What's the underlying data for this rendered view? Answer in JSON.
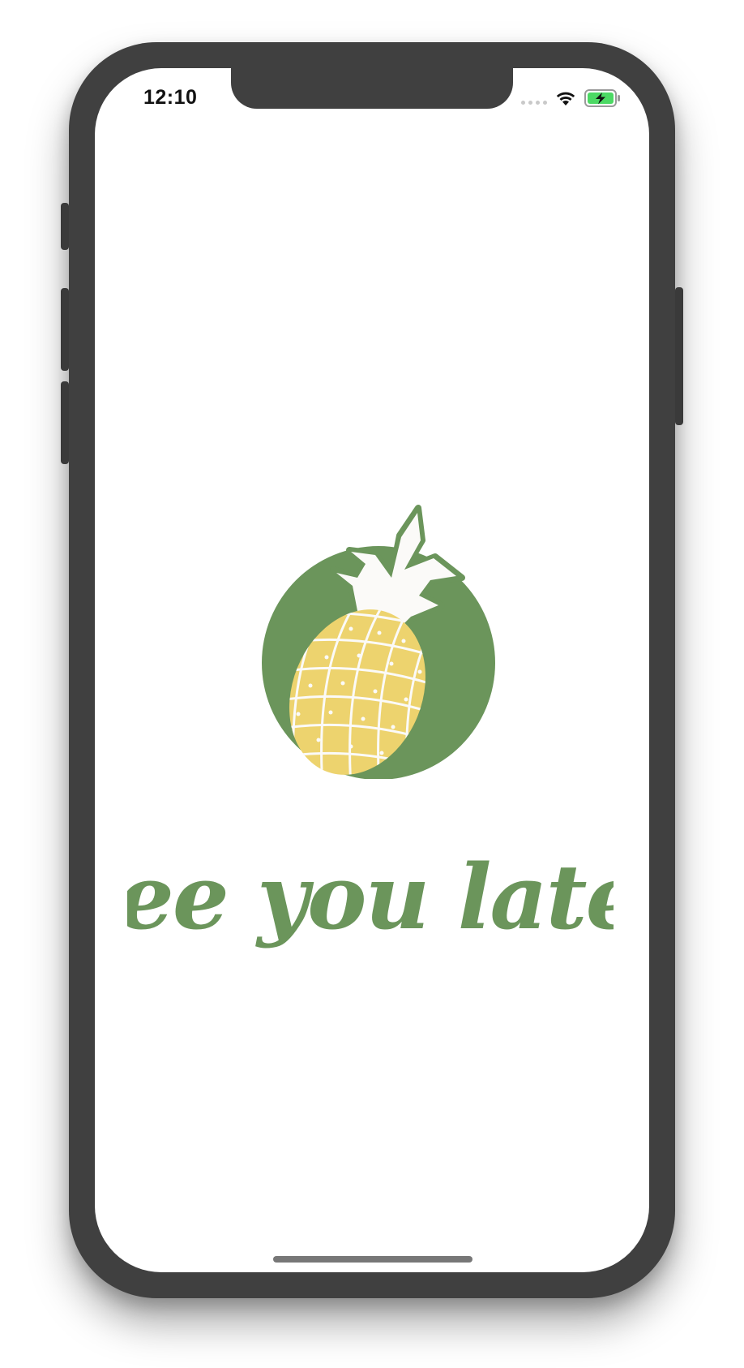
{
  "status_bar": {
    "time": "12:10",
    "wifi_icon": "wifi-icon",
    "battery_icon": "battery-charging-icon",
    "signal_icon": "cellular-no-signal-icon"
  },
  "splash": {
    "logo_icon": "pineapple-logo",
    "tagline": "See you later"
  },
  "colors": {
    "brand_green": "#6B955B",
    "pineapple_yellow": "#EDD36E",
    "leaf_white": "#FBFAF8",
    "battery_green": "#4CD964"
  }
}
